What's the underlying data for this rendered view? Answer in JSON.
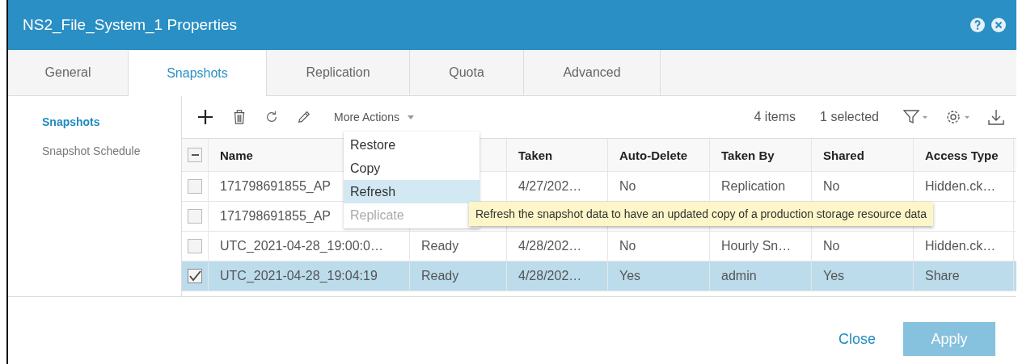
{
  "window": {
    "title": "NS2_File_System_1 Properties"
  },
  "tabs": [
    {
      "label": "General",
      "selected": false
    },
    {
      "label": "Snapshots",
      "selected": true
    },
    {
      "label": "Replication",
      "selected": false
    },
    {
      "label": "Quota",
      "selected": false
    },
    {
      "label": "Advanced",
      "selected": false
    }
  ],
  "sidebar": {
    "items": [
      {
        "label": "Snapshots",
        "selected": true
      },
      {
        "label": "Snapshot Schedule",
        "selected": false
      }
    ]
  },
  "toolbar": {
    "more_actions": "More Actions",
    "item_count": "4 items",
    "selected_count": "1 selected"
  },
  "table": {
    "select_all": {
      "indeterminate": true
    },
    "columns": [
      "Name",
      "",
      "Taken",
      "Auto-Delete",
      "Taken By",
      "Shared",
      "Access Type"
    ],
    "rows": [
      {
        "selected": false,
        "cells": [
          "171798691855_AP",
          "",
          "4/27/202…",
          "No",
          "Replication",
          "No",
          "Hidden.ck…"
        ]
      },
      {
        "selected": false,
        "cells": [
          "171798691855_AP",
          "",
          "",
          "",
          "",
          "",
          ""
        ]
      },
      {
        "selected": false,
        "cells": [
          "UTC_2021-04-28_19:00:0…",
          "Ready",
          "4/28/202…",
          "No",
          "Hourly Sn…",
          "No",
          "Hidden.ck…"
        ]
      },
      {
        "selected": true,
        "cells": [
          "UTC_2021-04-28_19:04:19",
          "Ready",
          "4/28/202…",
          "Yes",
          "admin",
          "Yes",
          "Share"
        ]
      }
    ]
  },
  "menu": {
    "items": [
      {
        "label": "Restore",
        "disabled": false,
        "selected": false
      },
      {
        "label": "Copy",
        "disabled": false,
        "selected": false
      },
      {
        "label": "Refresh",
        "disabled": false,
        "selected": true
      },
      {
        "label": "Replicate",
        "disabled": true,
        "selected": false
      }
    ]
  },
  "tooltip": "Refresh the snapshot data to have an updated copy of a production storage resource data",
  "buttons": {
    "close": "Close",
    "apply": "Apply"
  }
}
